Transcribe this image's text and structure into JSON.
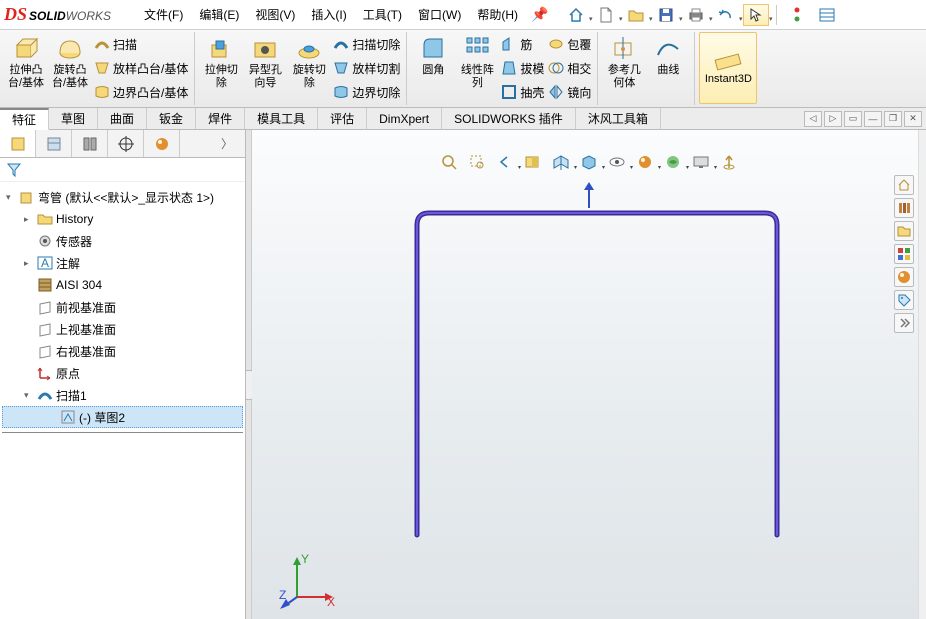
{
  "app": {
    "logo_bold": "SOLID",
    "logo_rest": "WORKS"
  },
  "menu": {
    "file": "文件(F)",
    "edit": "编辑(E)",
    "view": "视图(V)",
    "insert": "插入(I)",
    "tools": "工具(T)",
    "window": "窗口(W)",
    "help": "帮助(H)"
  },
  "ribbon": {
    "extrude": "拉伸凸\n台/基体",
    "revolve": "旋转凸\n台/基体",
    "sweep": "扫描",
    "loft": "放样凸台/基体",
    "boundary": "边界凸台/基体",
    "cut_extrude": "拉伸切\n除",
    "hole": "异型孔\n向导",
    "cut_revolve": "旋转切\n除",
    "cut_sweep": "扫描切除",
    "cut_loft": "放样切割",
    "cut_boundary": "边界切除",
    "fillet": "圆角",
    "linpat": "线性阵\n列",
    "rib": "筋",
    "draft": "拔模",
    "shell": "抽壳",
    "wrap": "包覆",
    "intersect": "相交",
    "mirror": "镜向",
    "refgeo": "参考几\n何体",
    "curves": "曲线",
    "instant3d": "Instant3D"
  },
  "tabs": {
    "feature": "特征",
    "sketch": "草图",
    "surface": "曲面",
    "sheetmetal": "钣金",
    "weldment": "焊件",
    "moldtools": "模具工具",
    "evaluate": "评估",
    "dimxpert": "DimXpert",
    "addins": "SOLIDWORKS 插件",
    "mofeng": "沐风工具箱"
  },
  "tree": {
    "root": "弯管  (默认<<默认>_显示状态 1>)",
    "history": "History",
    "sensors": "传感器",
    "annotations": "注解",
    "material": "AISI 304",
    "front": "前视基准面",
    "top": "上视基准面",
    "right": "右视基准面",
    "origin": "原点",
    "sweep1": "扫描1",
    "sketch2": "(-) 草图2"
  },
  "triad": {
    "x": "X",
    "y": "Y",
    "z": "Z"
  }
}
